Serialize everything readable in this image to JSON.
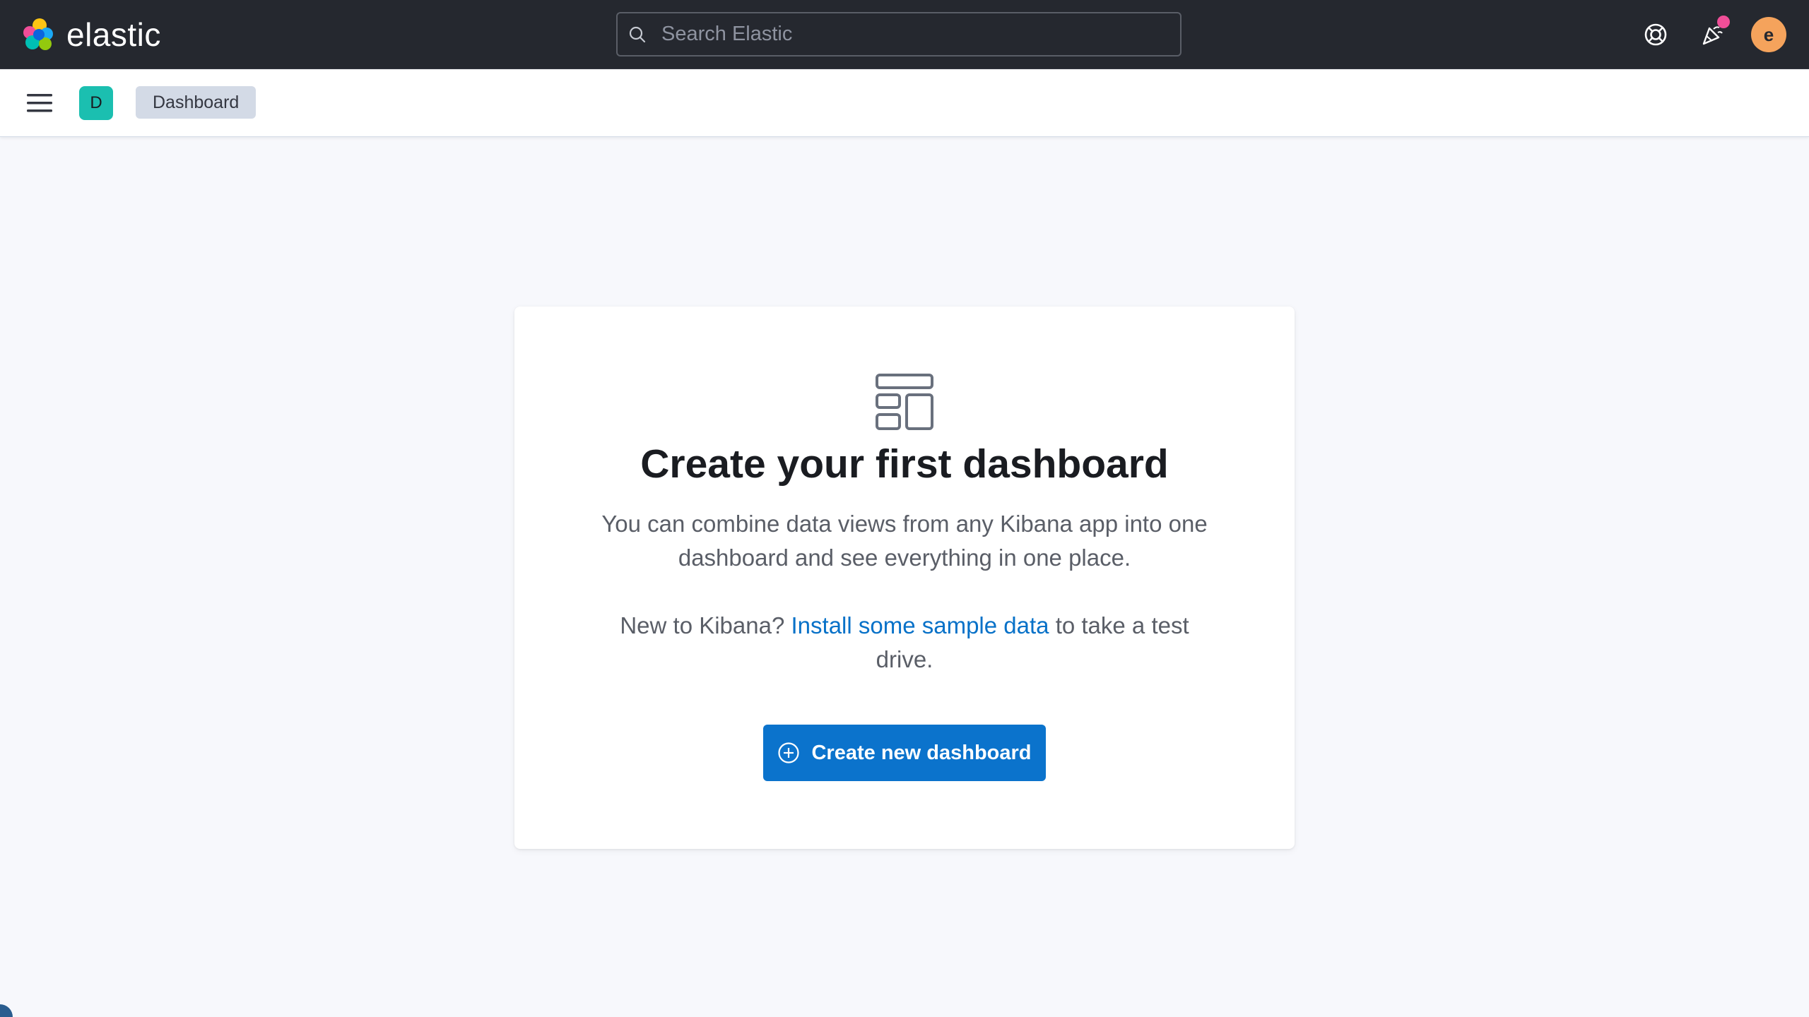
{
  "header": {
    "brand": "elastic",
    "search_placeholder": "Search Elastic",
    "user_initial": "e"
  },
  "subheader": {
    "space_initial": "D",
    "breadcrumb": "Dashboard"
  },
  "empty_prompt": {
    "title": "Create your first dashboard",
    "body": "You can combine data views from any Kibana app into one dashboard and see everything in one place.",
    "sample_prefix": "New to Kibana?",
    "sample_link": "Install some sample data",
    "sample_suffix": "to take a test drive.",
    "button_label": "Create new dashboard"
  },
  "colors": {
    "header_bg": "#25282f",
    "accent": "#0b73cc",
    "notification": "#f04e98",
    "user_avatar": "#f5a35c",
    "space_avatar": "#1bbfb0"
  }
}
